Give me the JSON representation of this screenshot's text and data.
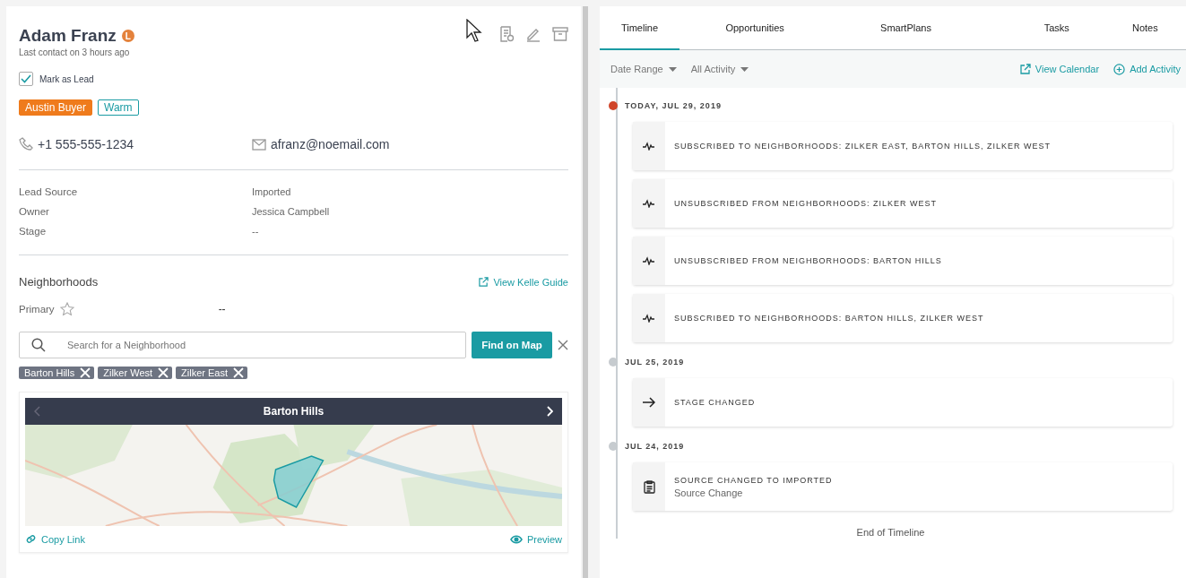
{
  "contact": {
    "name": "Adam Franz",
    "badge": "L",
    "last_contact": "Last contact on 3 hours ago",
    "mark_as_lead": {
      "label": "Mark as Lead",
      "checked": true
    },
    "tags": [
      {
        "label": "Austin Buyer",
        "kind": "solid"
      },
      {
        "label": "Warm",
        "kind": "outline"
      }
    ],
    "phone": "+1 555-555-1234",
    "email": "afranz@noemail.com",
    "fields": [
      {
        "label": "Lead Source",
        "value": "Imported"
      },
      {
        "label": "Owner",
        "value": "Jessica Campbell"
      },
      {
        "label": "Stage",
        "value": "--"
      }
    ]
  },
  "neighborhoods": {
    "title": "Neighborhoods",
    "guide_link": "View Kelle Guide",
    "primary_label": "Primary",
    "primary_value": "--",
    "search": {
      "placeholder": "Search for a Neighborhood"
    },
    "find_button": "Find on Map",
    "chips": [
      "Barton Hills",
      "Zilker West",
      "Zilker East"
    ],
    "map": {
      "title": "Barton Hills",
      "kind": "picture"
    },
    "copy_link": "Copy Link",
    "preview": "Preview"
  },
  "tabs": [
    {
      "label": "Timeline",
      "selected": true
    },
    {
      "label": "Opportunities",
      "selected": false
    },
    {
      "label": "SmartPlans",
      "selected": false
    },
    {
      "label": "Tasks",
      "selected": false
    },
    {
      "label": "Notes",
      "selected": false
    }
  ],
  "filters": [
    "Date Range",
    "All Activity"
  ],
  "actions": [
    {
      "label": "View Calendar",
      "kind": "external"
    },
    {
      "label": "Add Activity",
      "kind": "add"
    }
  ],
  "timeline": [
    {
      "date": "TODAY, JUL 29, 2019",
      "today": true,
      "events": [
        {
          "kind": "pulse",
          "title": "SUBSCRIBED TO NEIGHBORHOODS: ZILKER EAST, BARTON HILLS, ZILKER WEST"
        },
        {
          "kind": "pulse",
          "title": "UNSUBSCRIBED FROM NEIGHBORHOODS: ZILKER WEST"
        },
        {
          "kind": "pulse",
          "title": "UNSUBSCRIBED FROM NEIGHBORHOODS: BARTON HILLS"
        },
        {
          "kind": "pulse",
          "title": "SUBSCRIBED TO NEIGHBORHOODS: BARTON HILLS, ZILKER WEST"
        }
      ]
    },
    {
      "date": "JUL 25, 2019",
      "today": false,
      "events": [
        {
          "kind": "arrow",
          "title": "STAGE CHANGED"
        }
      ]
    },
    {
      "date": "JUL 24, 2019",
      "today": false,
      "events": [
        {
          "kind": "clipboard",
          "title": "SOURCE CHANGED TO IMPORTED",
          "subtitle": "Source Change"
        }
      ]
    }
  ],
  "end_text": "End of Timeline"
}
